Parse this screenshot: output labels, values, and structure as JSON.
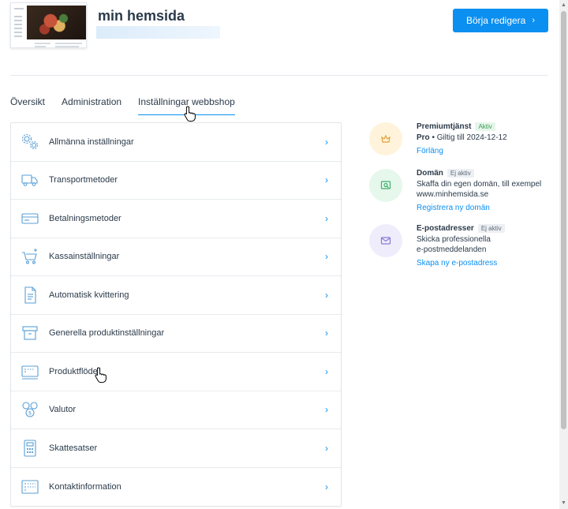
{
  "header": {
    "site_title": "min hemsida",
    "edit_button_label": "Börja redigera",
    "edit_button_chevron": "›"
  },
  "tabs": [
    {
      "label": "Översikt"
    },
    {
      "label": "Administration"
    },
    {
      "label": "Inställningar webbshop",
      "active": true
    }
  ],
  "settings": [
    {
      "label": "Allmänna inställningar",
      "icon": "gears-icon"
    },
    {
      "label": "Transportmetoder",
      "icon": "truck-icon"
    },
    {
      "label": "Betalningsmetoder",
      "icon": "credit-card-icon"
    },
    {
      "label": "Kassainställningar",
      "icon": "cart-icon"
    },
    {
      "label": "Automatisk kvittering",
      "icon": "document-icon"
    },
    {
      "label": "Generella produktinställningar",
      "icon": "box-icon"
    },
    {
      "label": "Produktflöde",
      "icon": "feed-icon"
    },
    {
      "label": "Valutor",
      "icon": "coins-icon"
    },
    {
      "label": "Skattesatser",
      "icon": "calculator-icon"
    },
    {
      "label": "Kontaktinformation",
      "icon": "contact-card-icon"
    }
  ],
  "arrow": "›",
  "features": {
    "premium": {
      "title": "Premiumtjänst",
      "badge": "Aktiv",
      "plan": "Pro",
      "validity": " • Giltig till 2024-12-12",
      "link": "Förläng",
      "icon": "crown-icon",
      "color": "#fff3dc"
    },
    "domain": {
      "title": "Domän",
      "badge": "Ej aktiv",
      "desc1": "Skaffa din egen domän, till exempel",
      "desc2": "www.minhemsida.se",
      "link": "Registrera ny domän",
      "icon": "domain-search-icon",
      "color": "#e6f7ec"
    },
    "email": {
      "title": "E-postadresser",
      "badge": "Ej aktiv",
      "desc1": "Skicka professionella",
      "desc2": "e-postmeddelanden",
      "link": "Skapa ny e-postadress",
      "icon": "envelope-icon",
      "color": "#efedfb"
    }
  },
  "colors": {
    "accent": "#0b8ff0",
    "text": "#2b3a4a"
  }
}
